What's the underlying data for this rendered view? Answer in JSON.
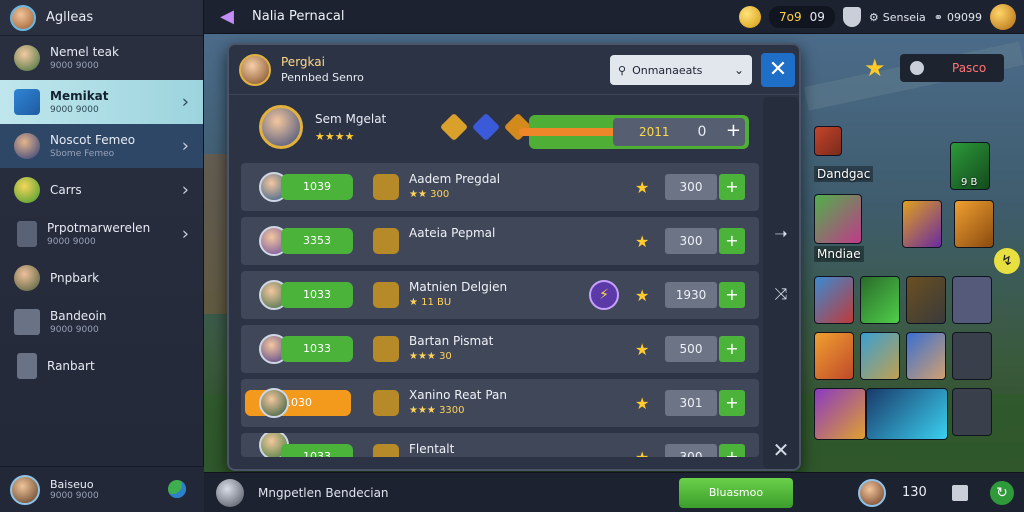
{
  "sidebar": {
    "header_title": "Aglleas",
    "items": [
      {
        "label": "Nemel teak",
        "sub": "9000 9000"
      },
      {
        "label": "Memikat",
        "sub": "9000 9000"
      },
      {
        "label": "Noscot Femeo",
        "sub": "Sbome Femeo"
      },
      {
        "label": "Carrs",
        "sub": ""
      },
      {
        "label": "Prpotmarwerelen",
        "sub": "9000 9000"
      },
      {
        "label": "Pnpbark",
        "sub": ""
      },
      {
        "label": "Bandeoin",
        "sub": "9000 9000"
      },
      {
        "label": "Ranbart",
        "sub": ""
      }
    ],
    "footer": {
      "label": "Baiseuo",
      "sub": "9000 9000"
    }
  },
  "topbar": {
    "title": "Nalia Pernacal",
    "coins": "7o9",
    "time": "09",
    "label_a": "Senseia",
    "label_b": "09099"
  },
  "modal": {
    "header_title": "Pergkai",
    "header_sub": "Pennbed Senro",
    "dropdown_label": "Onmanaeats",
    "summary_name": "Sem Mgelat",
    "summary_stars": "★★★★",
    "bar_value": "2011",
    "bar_count": "0",
    "rows": [
      {
        "tag": "1039",
        "name": "Aadem Pregdal",
        "sub": "★★ 300",
        "qty": "300",
        "tag_style": "green"
      },
      {
        "tag": "3353",
        "name": "Aateia Pepmal",
        "sub": "",
        "qty": "300",
        "tag_style": "green"
      },
      {
        "tag": "1033",
        "name": "Matnien Delgien",
        "sub": "★ 11 BU",
        "qty": "1930",
        "tag_style": "green",
        "bolt": true
      },
      {
        "tag": "1033",
        "name": "Bartan Pismat",
        "sub": "★★★ 30",
        "qty": "500",
        "tag_style": "green"
      },
      {
        "tag": "1030",
        "name": "Xanino Reat Pan",
        "sub": "★★★ 3300",
        "qty": "301",
        "tag_style": "orange"
      },
      {
        "tag": "1033",
        "name": "Flentalt",
        "sub": "",
        "qty": "300",
        "tag_style": "green"
      }
    ]
  },
  "rpanel": {
    "badge": "Pasco",
    "label_a": "Dandgac",
    "label_b": "Mndiae",
    "card_label": "9 B"
  },
  "bottombar": {
    "status": "Mngpetlen Bendecian",
    "button": "Bluasmoo",
    "count": "130"
  }
}
